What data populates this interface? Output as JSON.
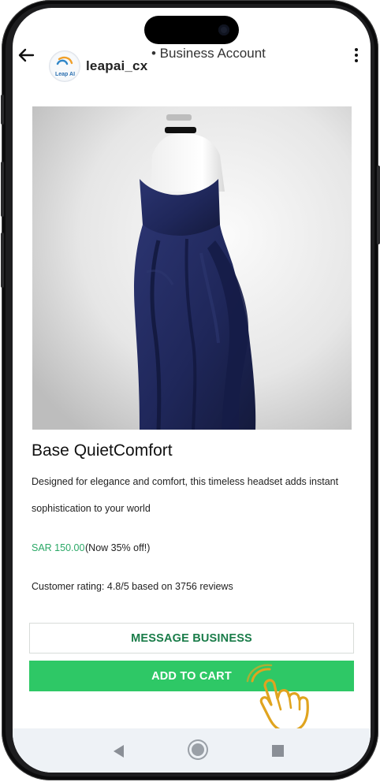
{
  "header": {
    "handle": "leapai_cx",
    "account_type": "• Business Account",
    "avatar_text": "Leap AI"
  },
  "product": {
    "title": "Base QuietComfort",
    "description_line1": "Designed for elegance and comfort, this timeless headset adds instant",
    "description_line2": "sophistication to your world",
    "price": "SAR 150.00",
    "discount_note": "(Now 35% off!)",
    "rating_text": "Customer rating: 4.8/5 based on 3756 reviews"
  },
  "buttons": {
    "message_business": "MESSAGE BUSINESS",
    "add_to_cart": "ADD TO CART"
  },
  "colors": {
    "price_green": "#2aa866",
    "cart_green": "#2ec866",
    "message_text_green": "#1a7c49",
    "hand_outline": "#e0a41f"
  },
  "icons": {
    "back": "arrow-left-icon",
    "menu": "more-vertical-icon",
    "hand": "tap-hand-icon",
    "nav_back": "triangle-back-icon",
    "nav_home": "circle-home-icon",
    "nav_recent": "square-recent-icon"
  }
}
